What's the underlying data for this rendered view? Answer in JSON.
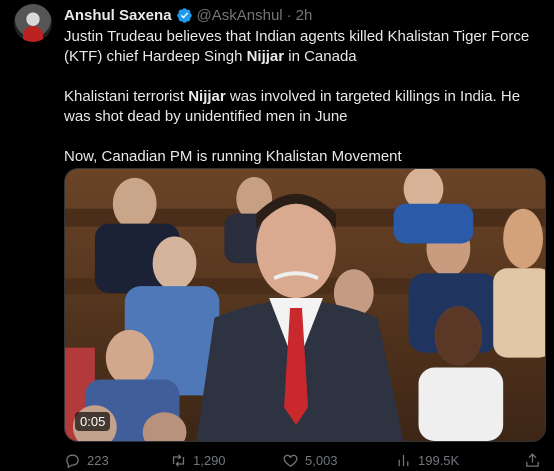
{
  "author": {
    "name": "Anshul Saxena",
    "handle": "@AskAnshul",
    "separator": "·",
    "time": "2h"
  },
  "text": {
    "p1_before": "Justin Trudeau believes that Indian agents killed Khalistan Tiger Force (KTF) chief Hardeep Singh ",
    "p1_bold": "Nijjar",
    "p1_after": " in Canada",
    "p2_before": "Khalistani terrorist ",
    "p2_bold": "Nijjar",
    "p2_after": " was involved in targeted killings in India. He was shot dead by unidentified men in June",
    "p3": "Now, Canadian PM is running Khalistan Movement"
  },
  "media": {
    "timestamp": "0:05"
  },
  "actions": {
    "replies": "223",
    "retweets": "1,290",
    "likes": "5,003",
    "views": "199.5K"
  },
  "colors": {
    "background": "#000000",
    "text": "#e7e9ea",
    "muted": "#71767b",
    "verified": "#1d9bf0"
  }
}
